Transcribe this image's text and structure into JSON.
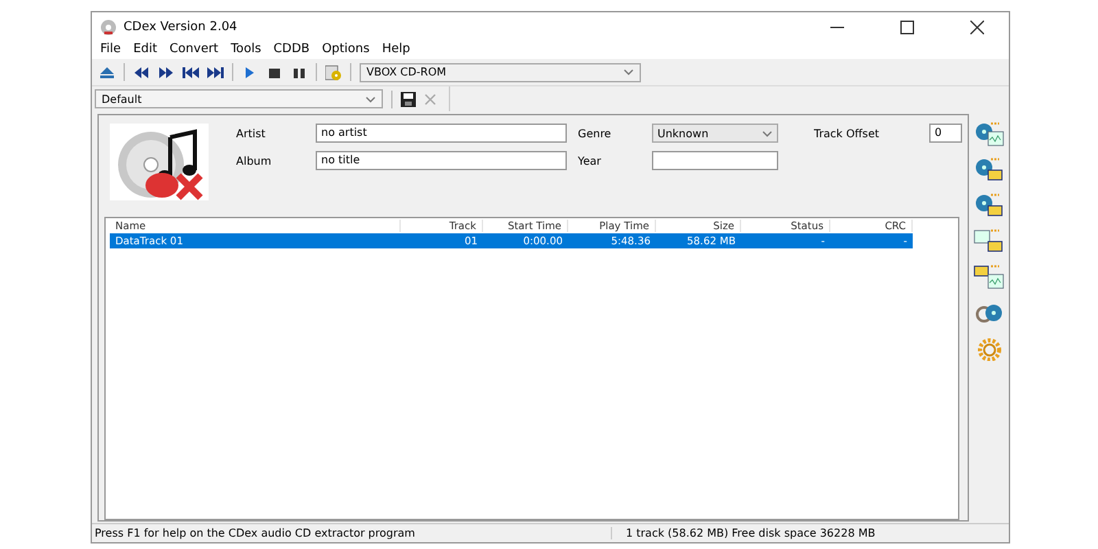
{
  "window": {
    "title": "CDex Version 2.04"
  },
  "menu": [
    "File",
    "Edit",
    "Convert",
    "Tools",
    "CDDB",
    "Options",
    "Help"
  ],
  "drive": {
    "value": "VBOX   CD-ROM"
  },
  "profile": {
    "value": "Default"
  },
  "fields": [
    {
      "kind": "text",
      "label": "Artist",
      "value": "no artist"
    },
    {
      "kind": "text",
      "label": "Album",
      "value": "no title"
    },
    {
      "kind": "select",
      "label": "Genre",
      "value": "Unknown"
    },
    {
      "kind": "text",
      "label": "Year"
    },
    {
      "kind": "small",
      "label": "Track Offset",
      "value": "0"
    }
  ],
  "table": {
    "columns": [
      "Name",
      "Track",
      "Start Time",
      "Play Time",
      "Size",
      "Status",
      "CRC"
    ],
    "rows": [
      {
        "selected": true,
        "cells": [
          "DataTrack 01",
          "01",
          "0:00.00",
          "5:48.36",
          "58.62 MB",
          "-",
          "-"
        ]
      }
    ]
  },
  "status_bar": [
    "Press F1 for help on the CDex audio CD extractor program",
    "1 track (58.62 MB) Free disk space 36228 MB"
  ]
}
